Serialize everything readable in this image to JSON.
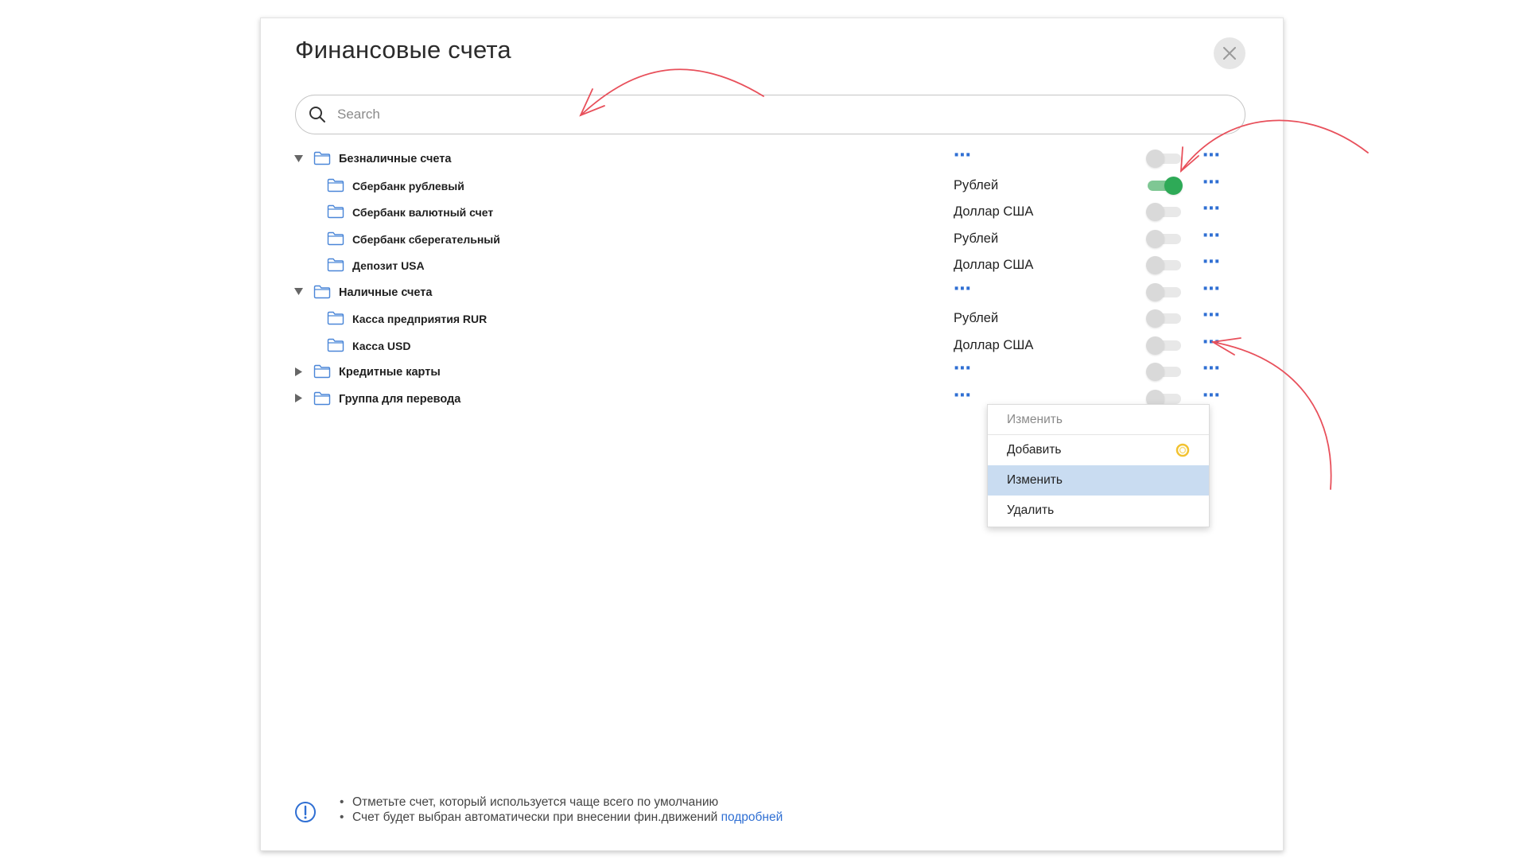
{
  "dialog": {
    "title": "Финансовые счета",
    "search": {
      "placeholder": "Search",
      "value": ""
    }
  },
  "tree": [
    {
      "id": "g1",
      "level": 0,
      "caret": "expanded",
      "label": "Безналичные счета",
      "currency": "",
      "toggle_on": false
    },
    {
      "id": "a1",
      "level": 1,
      "caret": "none",
      "label": "Сбербанк рублевый",
      "currency": "Рублей",
      "toggle_on": true
    },
    {
      "id": "a2",
      "level": 1,
      "caret": "none",
      "label": "Сбербанк валютный счет",
      "currency": "Доллар США",
      "toggle_on": false
    },
    {
      "id": "a3",
      "level": 1,
      "caret": "none",
      "label": "Сбербанк сберегательный",
      "currency": "Рублей",
      "toggle_on": false
    },
    {
      "id": "a4",
      "level": 1,
      "caret": "none",
      "label": "Депозит USA",
      "currency": "Доллар США",
      "toggle_on": false
    },
    {
      "id": "g2",
      "level": 0,
      "caret": "expanded",
      "label": "Наличные счета",
      "currency": "",
      "toggle_on": false
    },
    {
      "id": "a5",
      "level": 1,
      "caret": "none",
      "label": "Касса предприятия RUR",
      "currency": "Рублей",
      "toggle_on": false
    },
    {
      "id": "a6",
      "level": 1,
      "caret": "none",
      "label": "Касса USD",
      "currency": "Доллар США",
      "toggle_on": false
    },
    {
      "id": "g3",
      "level": 0,
      "caret": "collapsed",
      "label": "Кредитные карты",
      "currency": "",
      "toggle_on": false
    },
    {
      "id": "g4",
      "level": 0,
      "caret": "collapsed",
      "label": "Группа для перевода",
      "currency": "",
      "toggle_on": false
    }
  ],
  "context_menu": {
    "header": "Изменить",
    "items": [
      {
        "label": "Добавить",
        "marker": "ring-icon"
      },
      {
        "label": "Изменить",
        "active": true
      },
      {
        "label": "Удалить"
      }
    ]
  },
  "footer": {
    "notes": [
      "Отметьте счет, который используется чаще всего по умолчанию",
      "Счет будет выбран автоматически при внесении фин.движений"
    ],
    "link_text": "подробней"
  },
  "colors": {
    "accent": "#2f6fd3",
    "toggle_on": "#2eaa57",
    "menu_active": "#c9dcf1",
    "annotation": "#e8505b",
    "ring": "#f2c230"
  }
}
